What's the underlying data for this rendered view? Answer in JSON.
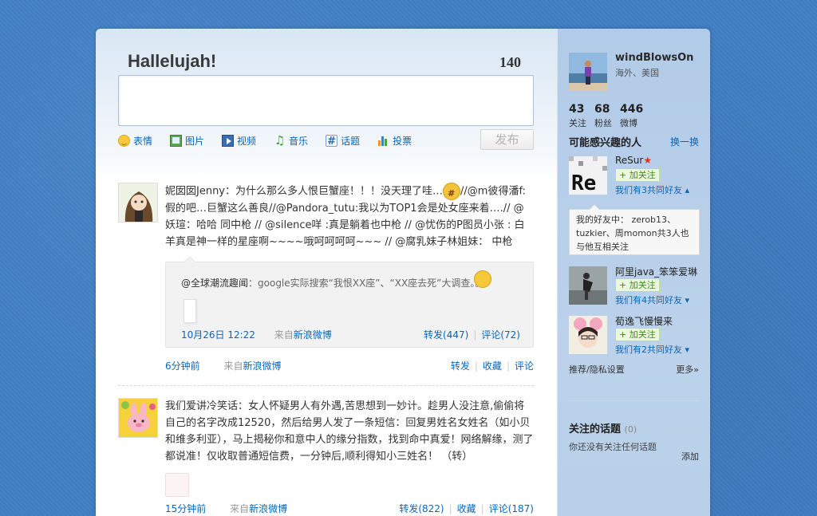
{
  "publisher": {
    "title": "Hallelujah!",
    "char_count": "140",
    "tools": [
      {
        "label": "表情",
        "icon": "emoticon-icon"
      },
      {
        "label": "图片",
        "icon": "picture-icon"
      },
      {
        "label": "视频",
        "icon": "video-icon"
      },
      {
        "label": "音乐",
        "icon": "music-icon"
      },
      {
        "label": "话题",
        "icon": "topic-icon"
      },
      {
        "label": "投票",
        "icon": "vote-icon"
      }
    ],
    "submit_label": "发布"
  },
  "feed": [
    {
      "text_parts": [
        "妮囡囡Jenny：为什么那么多人恨巨蟹座！！！没天理了哇…",
        "//@m彼得潘f:假的吧…巨蟹这么善良//@Pandora_tutu:我以为TOP1会是处女座来着….// @妖瑄：哈哈 同中枪 // @silence咩 :真是躺着也中枪 // @忧伤的P图员小张 : 白羊真是神一样的星座啊~~~~哦呵呵呵呵~~~ // @腐乳妹子林姐妹： 中枪"
      ],
      "quote": {
        "author": "@全球潮流趣闻",
        "text": "：google实际搜索“我恨XX座”、“XX座去死”大调查。。。",
        "time": "10月26日 12:22",
        "from_prefix": "来自",
        "from_app": "新浪微博",
        "repost": "转发(447)",
        "comment": "评论(72)"
      },
      "time": "6分钟前",
      "from_prefix": "来自",
      "from_app": "新浪微博",
      "actions": [
        "转发",
        "收藏",
        "评论"
      ]
    },
    {
      "text": "我们爱讲冷笑话：女人怀疑男人有外遇,苦思想到一妙计。趁男人没注意,偷偷将自己的名字改成12520，然后给男人发了一条短信：回复男姓名女姓名（如小贝和维多利亚），马上揭秘你和意中人的缘分指数，找到命中真爱！网络解缘，测了都说准！仅收取普通短信费，一分钟后,顺利得知小三姓名！ （转）",
      "time": "15分钟前",
      "from_prefix": "来自",
      "from_app": "新浪微博",
      "repost": "转发(822)",
      "favorite": "收藏",
      "comment": "评论(187)"
    }
  ],
  "sidebar": {
    "user": {
      "name": "windBlowsOn",
      "location": "海外、美国"
    },
    "stats": [
      {
        "num": "43",
        "label": "关注"
      },
      {
        "num": "68",
        "label": "粉丝"
      },
      {
        "num": "446",
        "label": "微博"
      }
    ],
    "suggest_title": "可能感兴趣的人",
    "suggest_refresh": "换一换",
    "follow_label": "+ 加关注",
    "suggestions": [
      {
        "name": "ReSur",
        "mutual": "我们有3共同好友"
      },
      {
        "name": "阿里java_笨笨爱琳",
        "mutual": "我们有4共同好友"
      },
      {
        "name": "荀逸飞慢慢来",
        "mutual": "我们有2共同好友"
      }
    ],
    "tip_text": "我的好友中：  zerob13、tuzkier、周momon共3人也与他互相关注",
    "settings": "推荐/隐私设置",
    "more": "更多»",
    "topics_title": "关注的话题",
    "topics_count": "(0)",
    "topics_empty": "你还没有关注任何话题",
    "topics_add": "添加"
  }
}
